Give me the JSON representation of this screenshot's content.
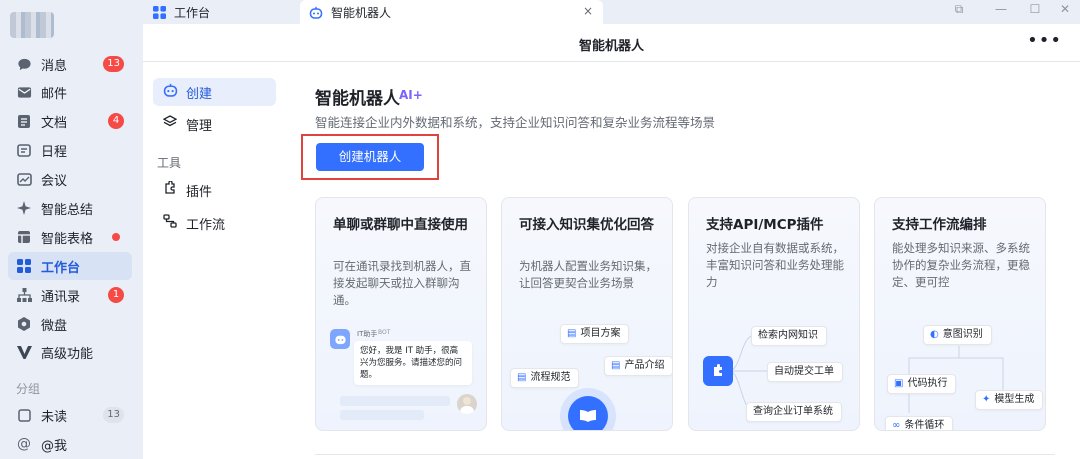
{
  "sidebar": {
    "items": [
      {
        "label": "消息",
        "icon": "message-icon",
        "badge": "13"
      },
      {
        "label": "邮件",
        "icon": "mail-icon"
      },
      {
        "label": "文档",
        "icon": "doc-icon",
        "badge": "4"
      },
      {
        "label": "日程",
        "icon": "calendar-icon"
      },
      {
        "label": "会议",
        "icon": "meeting-icon"
      },
      {
        "label": "智能总结",
        "icon": "sparkle-icon"
      },
      {
        "label": "智能表格",
        "icon": "table-icon",
        "dot": true
      },
      {
        "label": "工作台",
        "icon": "grid-icon",
        "active": true
      },
      {
        "label": "通讯录",
        "icon": "contacts-icon",
        "badge": "1"
      },
      {
        "label": "微盘",
        "icon": "drive-icon"
      },
      {
        "label": "高级功能",
        "icon": "advanced-icon"
      }
    ],
    "group_label": "分组",
    "group_items": [
      {
        "label": "未读",
        "icon": "unread-icon",
        "badge": "13"
      },
      {
        "label": "@我",
        "icon": "at-icon"
      }
    ]
  },
  "tabs": [
    {
      "label": "工作台",
      "icon": "grid-icon"
    },
    {
      "label": "智能机器人",
      "icon": "robot-icon",
      "close": "×"
    }
  ],
  "window_controls": [
    "⧉",
    "—",
    "☐",
    "✕"
  ],
  "header": {
    "title": "智能机器人",
    "more": "•••"
  },
  "subnav": {
    "items": [
      {
        "label": "创建",
        "icon": "robot-icon",
        "active": true
      },
      {
        "label": "管理",
        "icon": "layers-icon"
      }
    ],
    "section": "工具",
    "tool_items": [
      {
        "label": "插件",
        "icon": "plugin-icon"
      },
      {
        "label": "工作流",
        "icon": "workflow-icon"
      }
    ]
  },
  "main": {
    "title": "智能机器人",
    "ai_tag": "AI+",
    "description": "智能连接企业内外数据和系统，支持企业知识问答和复杂业务流程等场景",
    "cta_label": "创建机器人",
    "cards": [
      {
        "title": "单聊或群聊中直接使用",
        "desc": "可在通讯录找到机器人，直接发起聊天或拉入群聊沟通。",
        "chat_name": "IT助手",
        "chat_tag": "BOT",
        "chat_text": "您好，我是 IT 助手，很高兴为您服务。请描述您的问题。"
      },
      {
        "title": "可接入知识集优化回答",
        "desc": "为机器人配置业务知识集，让回答更契合业务场景",
        "pills": [
          "项目方案",
          "产品介绍",
          "流程规范"
        ]
      },
      {
        "title": "支持API/MCP插件",
        "desc": "对接企业自有数据或系统，丰富知识问答和业务处理能力",
        "pills": [
          "检索内网知识",
          "自动提交工单",
          "查询企业订单系统"
        ]
      },
      {
        "title": "支持工作流编排",
        "desc": "能处理多知识来源、多系统协作的复杂业务流程，更稳定、更可控",
        "pills": [
          "意图识别",
          "代码执行",
          "模型生成",
          "条件循环"
        ]
      }
    ]
  },
  "colors": {
    "accent": "#3370ff",
    "badge": "#f54a45",
    "ai": "#7b61ff",
    "highlight": "#e0433b"
  }
}
